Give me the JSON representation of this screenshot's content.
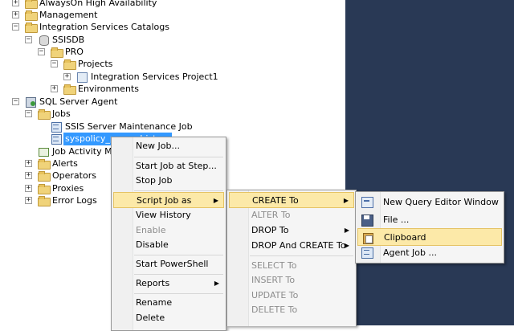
{
  "tree": {
    "alwayson": "AlwaysOn High Availability",
    "management": "Management",
    "isc": "Integration Services Catalogs",
    "ssisdb": "SSISDB",
    "pro": "PRO",
    "projects": "Projects",
    "project1": "Integration Services Project1",
    "environments": "Environments",
    "agent": "SQL Server Agent",
    "jobs": "Jobs",
    "job1": "SSIS Server Maintenance Job",
    "job2": "syspolicy_purge_history",
    "activity_monitor": "Job Activity Monitor",
    "alerts": "Alerts",
    "operators": "Operators",
    "proxies": "Proxies",
    "error_logs": "Error Logs"
  },
  "context_menu": {
    "new_job": "New Job...",
    "start_job_at_step": "Start Job at Step...",
    "stop_job": "Stop Job",
    "script_job_as": "Script Job as",
    "view_history": "View History",
    "enable": "Enable",
    "disable": "Disable",
    "start_powershell": "Start PowerShell",
    "reports": "Reports",
    "rename": "Rename",
    "delete": "Delete"
  },
  "script_menu": {
    "create_to": "CREATE To",
    "alter_to": "ALTER To",
    "drop_to": "DROP To",
    "drop_and_create_to": "DROP And CREATE To",
    "select_to": "SELECT To",
    "insert_to": "INSERT To",
    "update_to": "UPDATE To",
    "delete_to": "DELETE To"
  },
  "create_menu": {
    "new_query_editor_window": "New Query Editor Window",
    "file": "File ...",
    "clipboard": "Clipboard",
    "agent_job": "Agent Job ..."
  },
  "icons": {
    "expand": "+",
    "collapse": "−",
    "submenu_arrow": "▶"
  },
  "colors": {
    "background_dark": "#293955",
    "selection": "#3399ff",
    "menu_highlight": "#fce9a8"
  }
}
